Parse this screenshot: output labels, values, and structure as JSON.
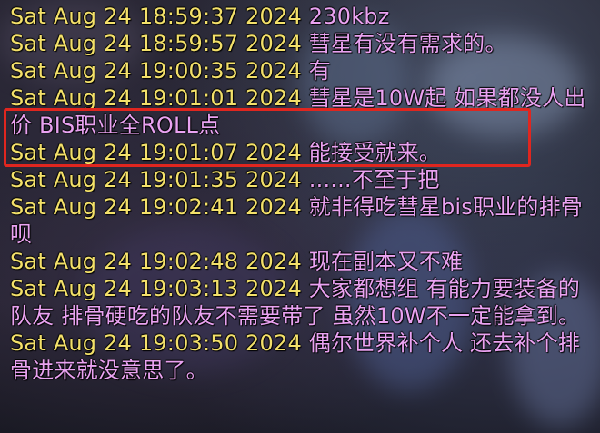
{
  "chat": {
    "lines": [
      {
        "timestamp": "Sat Aug 24 18:59:37 2024",
        "message": "230kbz"
      },
      {
        "timestamp": "Sat Aug 24 18:59:57 2024",
        "message": "彗星有没有需求的。"
      },
      {
        "timestamp": "Sat Aug 24 19:00:35 2024",
        "message": "有"
      },
      {
        "timestamp": "Sat Aug 24 19:01:01 2024",
        "message": "彗星是10W起  如果都没人出价 BIS职业全ROLL点"
      },
      {
        "timestamp": "Sat Aug 24 19:01:07 2024",
        "message": "能接受就来。"
      },
      {
        "timestamp": "Sat Aug 24 19:01:35 2024",
        "message": "......不至于把"
      },
      {
        "timestamp": "Sat Aug 24 19:02:41 2024",
        "message": "就非得吃彗星bis职业的排骨呗"
      },
      {
        "timestamp": "Sat Aug 24 19:02:48 2024",
        "message": "现在副本又不难"
      },
      {
        "timestamp": "Sat Aug 24 19:03:13 2024",
        "message": "大家都想组 有能力要装备的队友  排骨硬吃的队友不需要带了 虽然10W不一定能拿到。"
      },
      {
        "timestamp": "Sat Aug 24 19:03:50 2024",
        "message": "偶尔世界补个人 还去补个排骨进来就没意思了。"
      }
    ]
  },
  "colors": {
    "timestamp": "#f3e06a",
    "message": "#e9a2f1",
    "highlight_border": "#e0261f"
  }
}
